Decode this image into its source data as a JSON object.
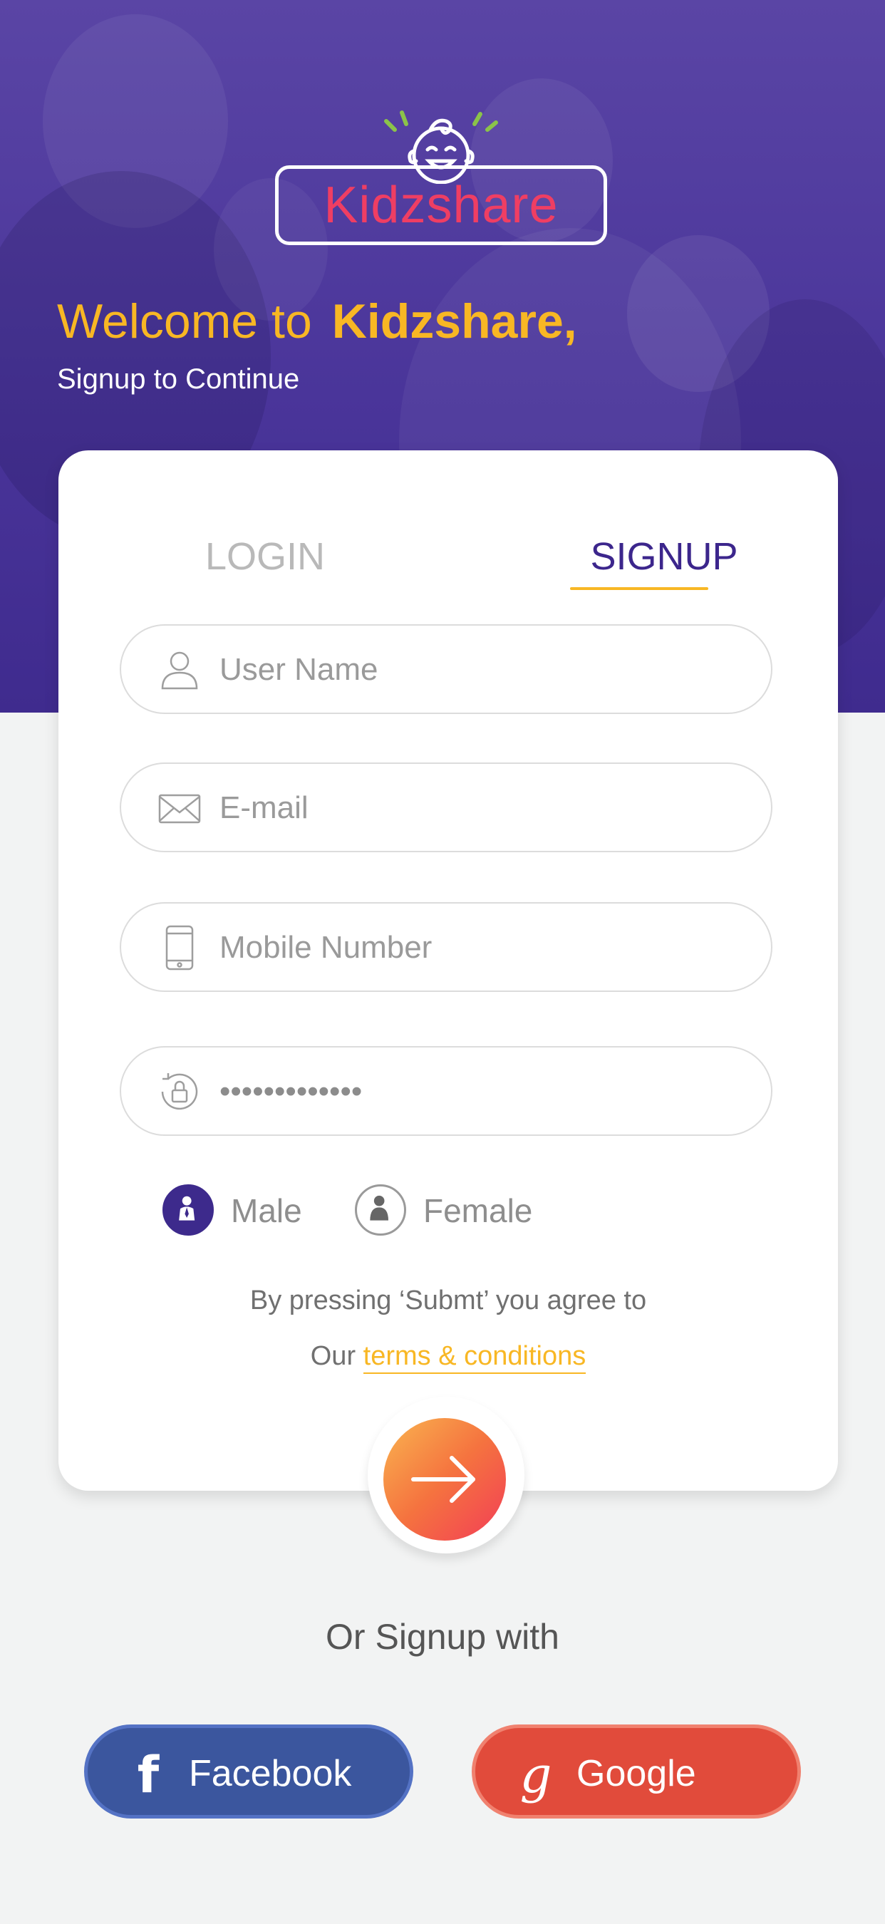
{
  "app": {
    "name": "Kidzshare"
  },
  "colors": {
    "primary": "#4a359a",
    "accent": "#f8b724",
    "logo_text": "#ef3e63",
    "facebook": "#3b569e",
    "google": "#e14b3b"
  },
  "header": {
    "welcome_prefix": "Welcome to",
    "welcome_brand": "Kidzshare,",
    "subtitle": "Signup to Continue"
  },
  "tabs": {
    "login": "LOGIN",
    "signup": "SIGNUP",
    "active": "signup"
  },
  "form": {
    "username": {
      "placeholder": "User Name",
      "icon": "user-icon"
    },
    "email": {
      "placeholder": "E-mail",
      "icon": "mail-icon"
    },
    "mobile": {
      "placeholder": "Mobile Number",
      "icon": "phone-icon"
    },
    "password": {
      "value": "*************",
      "icon": "lock-icon"
    }
  },
  "gender": {
    "male": "Male",
    "female": "Female",
    "selected": "male"
  },
  "agreement": {
    "line1": "By pressing ‘Submt’ you agree to",
    "prefix": "Our",
    "terms_link": "terms & conditions"
  },
  "submit": {
    "icon": "arrow-right-icon"
  },
  "social": {
    "heading": "Or Signup with",
    "facebook": {
      "label": "Facebook",
      "icon": "f"
    },
    "google": {
      "label": "Google",
      "icon": "g"
    }
  }
}
